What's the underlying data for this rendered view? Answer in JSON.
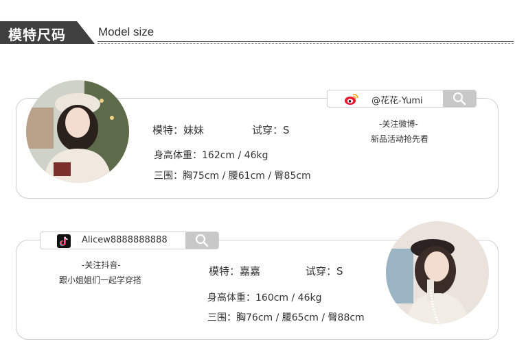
{
  "header": {
    "title": "模特尺码",
    "subtitle": "Model size"
  },
  "models": [
    {
      "name_label": "模特：妹妹",
      "size_label": "试穿：S",
      "height_weight": "身高体重：162cm / 46kg",
      "measurements": "三围：胸75cm / 腰61cm / 臀85cm",
      "social": {
        "platform_icon": "weibo-icon",
        "handle": "@花花-Yumi",
        "follow_text": "-关注微博-",
        "tagline": "新品活动抢先看"
      }
    },
    {
      "name_label": "模特：嘉嘉",
      "size_label": "试穿：S",
      "height_weight": "身高体重：160cm / 46kg",
      "measurements": "三围：胸76cm / 腰65cm / 臀88cm",
      "social": {
        "platform_icon": "douyin-icon",
        "handle": "Alicew8888888888",
        "follow_text": "-关注抖音-",
        "tagline": "跟小姐姐们一起学穿搭"
      }
    }
  ],
  "colors": {
    "header_tab": "#3f3f3f",
    "card_border": "#cfcfcf",
    "search_button": "#c8c8c8",
    "weibo_red": "#e6162d",
    "weibo_orange": "#f5a623"
  }
}
